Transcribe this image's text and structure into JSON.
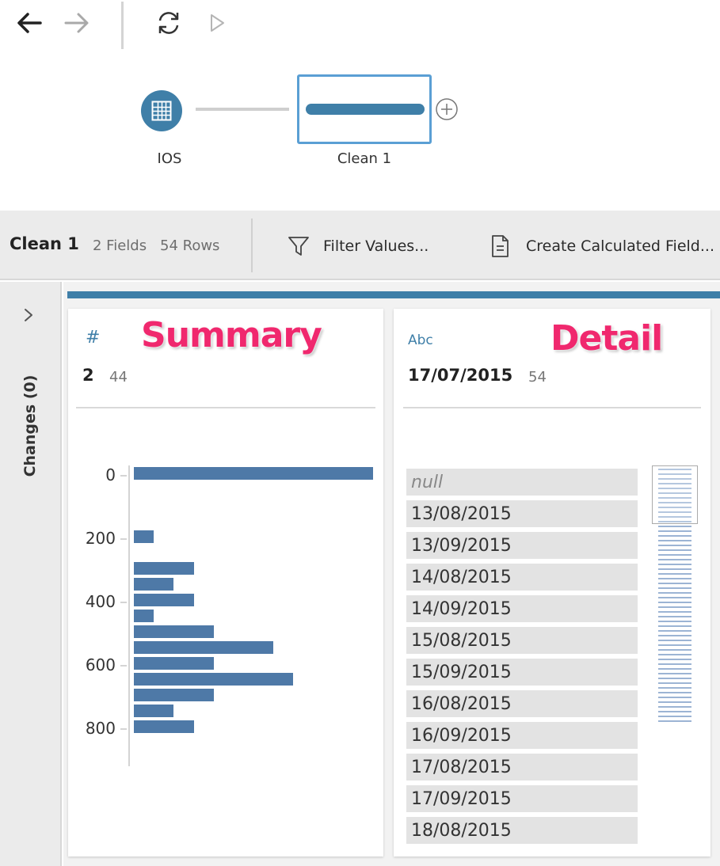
{
  "toolbar": {
    "back_icon": "arrow-left-icon",
    "forward_icon": "arrow-right-icon",
    "refresh_icon": "refresh-icon",
    "run_icon": "play-icon"
  },
  "flow": {
    "input_node": {
      "label": "IOS",
      "icon": "table-icon",
      "color": "#3f7fa8"
    },
    "clean_node": {
      "label": "Clean 1",
      "color": "#3f7fa8",
      "border": "#5a9fd4"
    },
    "add_icon": "plus-circle-icon"
  },
  "step_header": {
    "title": "Clean 1",
    "fields": "2 Fields",
    "rows": "54 Rows",
    "filter_label": "Filter Values...",
    "calc_label": "Create Calculated Field..."
  },
  "rail": {
    "toggle_icon": "chevron-right-icon",
    "changes_label": "Changes (0)"
  },
  "summary_card": {
    "type_glyph": "#",
    "field_name": "2",
    "distinct_count": "44",
    "annotation": "Summary",
    "tick_labels": [
      "0",
      "200",
      "400",
      "600",
      "800"
    ],
    "bin_counts": [
      12,
      0,
      0,
      0,
      1,
      0,
      3,
      2,
      3,
      1,
      4,
      7,
      4,
      8,
      4,
      2,
      3
    ]
  },
  "detail_card": {
    "type_glyph": "Abc",
    "field_name": "17/07/2015",
    "distinct_count": "54",
    "annotation": "Detail",
    "values": [
      "null",
      "13/08/2015",
      "13/09/2015",
      "14/08/2015",
      "14/09/2015",
      "15/08/2015",
      "15/09/2015",
      "16/08/2015",
      "16/09/2015",
      "17/08/2015",
      "17/09/2015",
      "18/08/2015"
    ]
  },
  "colors": {
    "accent": "#3f7fa8",
    "bar": "#4e79a7",
    "annotation": "#f0286e"
  }
}
